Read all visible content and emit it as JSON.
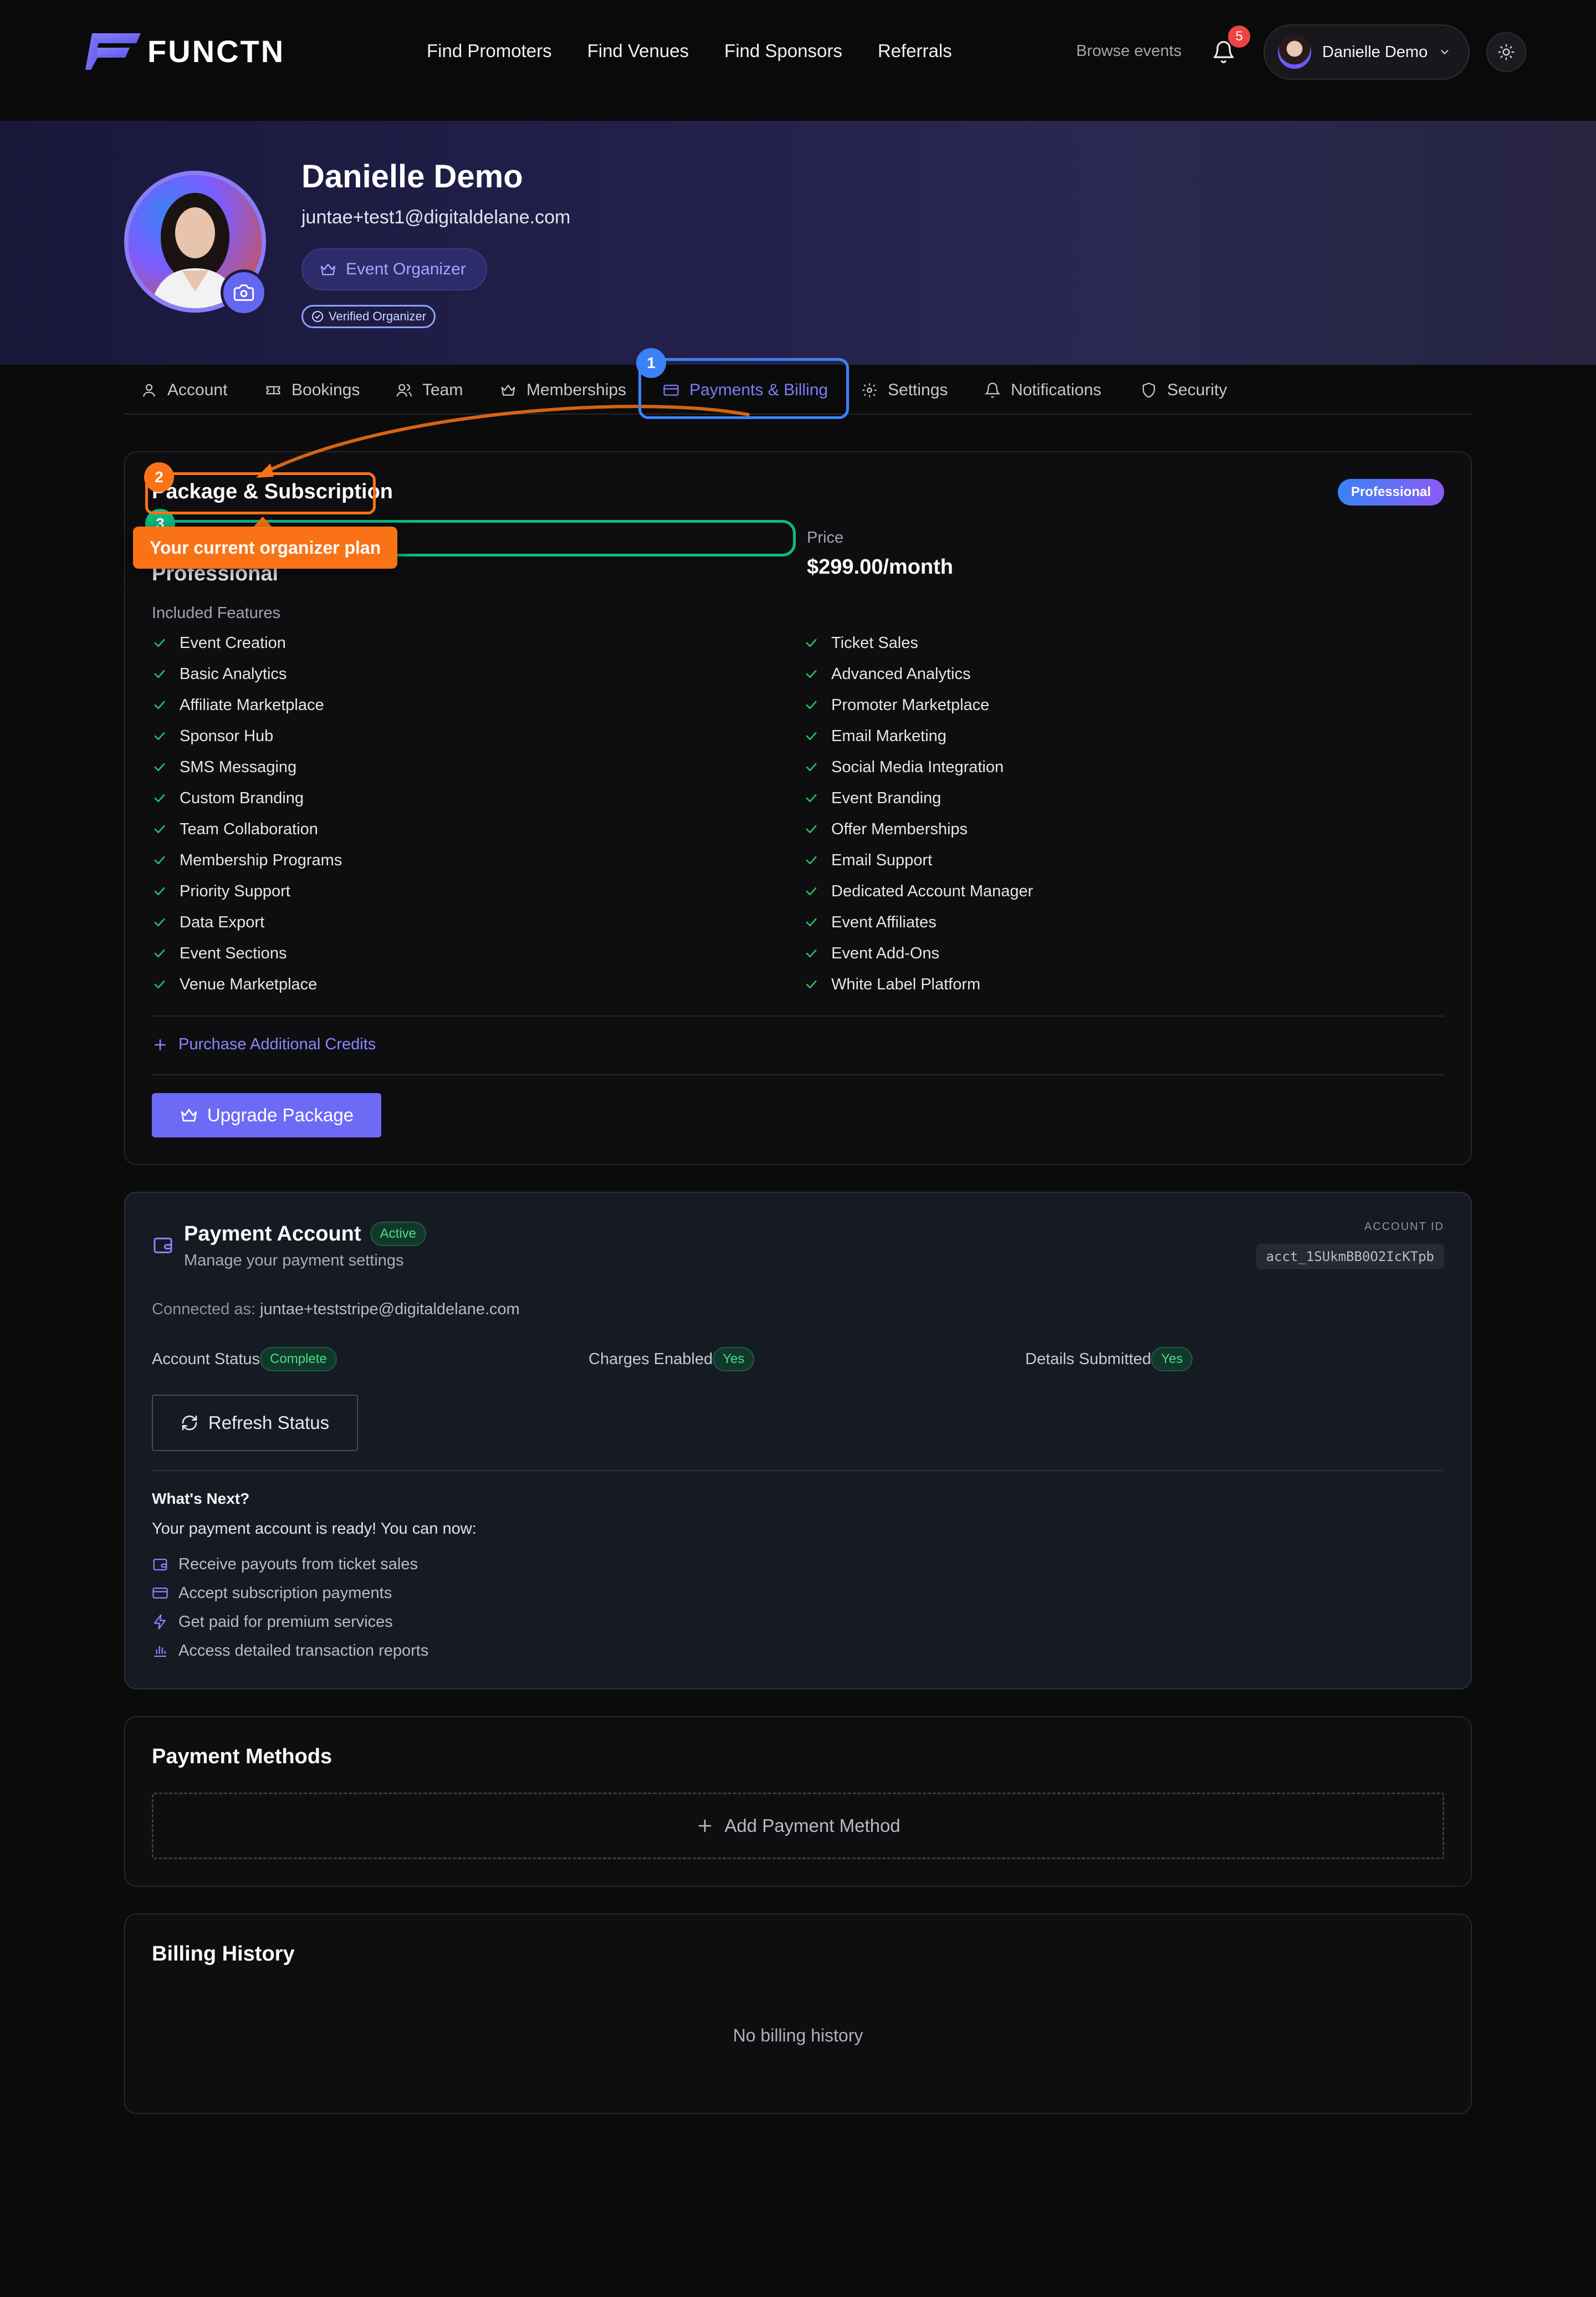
{
  "brand": {
    "name": "FUNCTN"
  },
  "nav": {
    "links": [
      "Find Promoters",
      "Find Venues",
      "Find Sponsors",
      "Referrals"
    ],
    "browse_events": "Browse events",
    "notification_count": "5",
    "user_name": "Danielle Demo"
  },
  "profile": {
    "name": "Danielle Demo",
    "email": "juntae+test1@digitaldelane.com",
    "role": "Event Organizer",
    "verified": "Verified Organizer"
  },
  "tabs": [
    "Account",
    "Bookings",
    "Team",
    "Memberships",
    "Payments & Billing",
    "Settings",
    "Notifications",
    "Security"
  ],
  "active_tab": "Payments & Billing",
  "tour": {
    "step1": "1",
    "step2": "2",
    "step3": "3",
    "tooltip": "Your current organizer plan"
  },
  "package": {
    "title": "Package & Subscription",
    "badge": "Professional",
    "plan_value": "Professional",
    "price_label": "Price",
    "price_value": "$299.00/month",
    "features_label": "Included Features",
    "features_left": [
      "Event Creation",
      "Basic Analytics",
      "Affiliate Marketplace",
      "Sponsor Hub",
      "SMS Messaging",
      "Custom Branding",
      "Team Collaboration",
      "Membership Programs",
      "Priority Support",
      "Data Export",
      "Event Sections",
      "Venue Marketplace"
    ],
    "features_right": [
      "Ticket Sales",
      "Advanced Analytics",
      "Promoter Marketplace",
      "Email Marketing",
      "Social Media Integration",
      "Event Branding",
      "Offer Memberships",
      "Email Support",
      "Dedicated Account Manager",
      "Event Affiliates",
      "Event Add-Ons",
      "White Label Platform"
    ],
    "purchase_credits": "Purchase Additional Credits",
    "upgrade_button": "Upgrade Package"
  },
  "payment_account": {
    "title": "Payment Account",
    "status_pill": "Active",
    "subtitle": "Manage your payment settings",
    "account_id_label": "ACCOUNT ID",
    "account_id": "acct_1SUkmBB0O2IcKTpb",
    "connected_label": "Connected as:",
    "connected_email": "juntae+teststripe@digitaldelane.com",
    "account_status_label": "Account Status",
    "account_status_value": "Complete",
    "charges_label": "Charges Enabled",
    "charges_value": "Yes",
    "details_label": "Details Submitted",
    "details_value": "Yes",
    "refresh_button": "Refresh Status",
    "whats_next_title": "What's Next?",
    "whats_next_text": "Your payment account is ready! You can now:",
    "next_items": [
      "Receive payouts from ticket sales",
      "Accept subscription payments",
      "Get paid for premium services",
      "Access detailed transaction reports"
    ]
  },
  "payment_methods": {
    "title": "Payment Methods",
    "add_button": "Add Payment Method"
  },
  "billing_history": {
    "title": "Billing History",
    "empty": "No billing history"
  },
  "colors": {
    "accent": "#6d6af5",
    "tour_blue": "#3b82f6",
    "tour_orange": "#f97316",
    "tour_green": "#10b981",
    "success": "#4ade80"
  }
}
